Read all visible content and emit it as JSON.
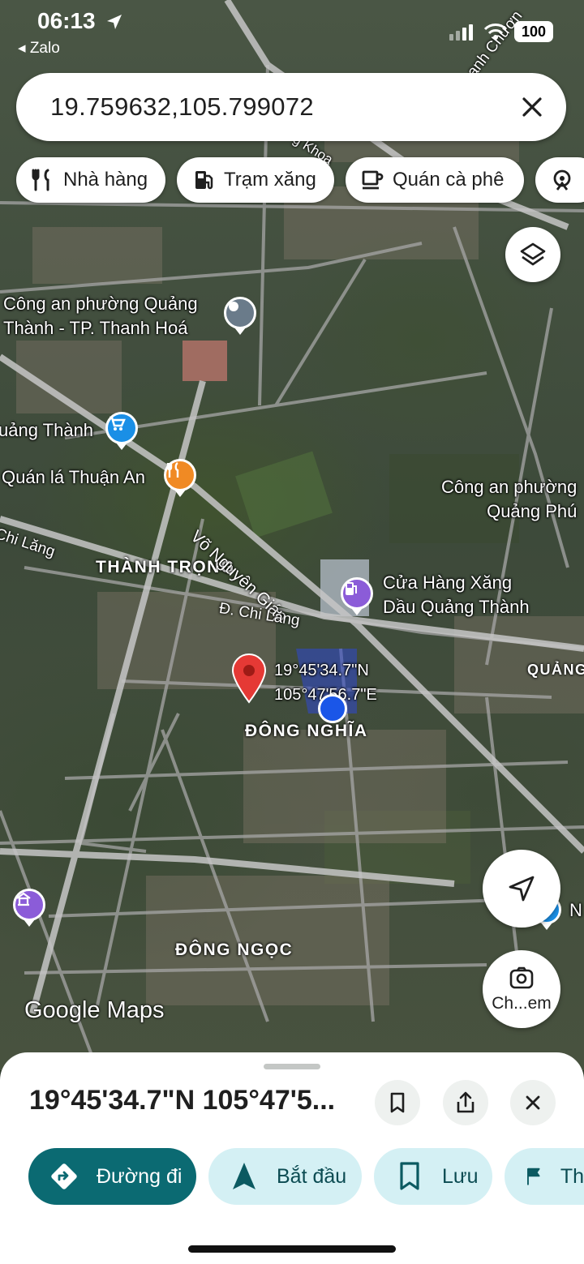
{
  "status_bar": {
    "time": "06:13",
    "back_app": "◂ Zalo",
    "battery": "100"
  },
  "search": {
    "value": "19.759632,105.799072",
    "close_icon": "close-icon"
  },
  "chips": [
    {
      "label": "Nhà hàng",
      "icon": "restaurant-icon"
    },
    {
      "label": "Trạm xăng",
      "icon": "gas-station-icon"
    },
    {
      "label": "Quán cà phê",
      "icon": "coffee-icon"
    },
    {
      "label": "",
      "icon": "attractions-icon"
    }
  ],
  "map": {
    "labels": {
      "police_quang_thanh": "Công an phường Quảng\nThành - TP. Thanh Hoá",
      "market_quang_thanh": "uảng Thành",
      "restaurant_thuan_an": "Quán lá Thuận An",
      "police_quang_phu": "Công an phường\nQuảng Phú",
      "gas_station": "Cửa Hàng Xăng\nDầu Quảng Thành",
      "area_thanh_trong": "THÀNH TRỌNG",
      "area_dong_nghia": "ĐÔNG NGHĨA",
      "area_dong_ngoc": "ĐÔNG NGỌC",
      "area_quang": "QUẢNG",
      "road_vo_nguyen_giap": "Võ Nguyên Giáp",
      "road_chi_lang": "Đ. Chi Lăng",
      "road_chi_lang_left": "Chi Lăng",
      "road_thanh_chuong": "anh Chươn",
      "road_khoa": "g Khoa",
      "pin_coords": "19°45'34.7\"N\n105°47'56.7\"E",
      "edge_n": "N"
    }
  },
  "buttons": {
    "layers_icon": "layers-icon",
    "recenter_icon": "navigation-arrow-icon",
    "lens_label": "Ch...em",
    "lens_icon": "camera-search-icon"
  },
  "logo": "Google Maps",
  "sheet": {
    "title": "19°45'34.7\"N 105°47'5...",
    "actions": [
      {
        "label": "Đường đi",
        "icon": "directions-icon"
      },
      {
        "label": "Bắt đầu",
        "icon": "navigation-icon"
      },
      {
        "label": "Lưu",
        "icon": "bookmark-icon"
      },
      {
        "label": "Th",
        "icon": "flag-icon"
      }
    ]
  },
  "colors": {
    "primary": "#0b6a72",
    "secondary_bg": "#d4f0f4",
    "pin_red": "#e53935",
    "location_blue": "#1a56e8",
    "poi_blue": "#1a8fe6",
    "poi_orange": "#f08a24",
    "poi_purple": "#8b5cd8",
    "poi_gray": "#6a7b8a"
  }
}
